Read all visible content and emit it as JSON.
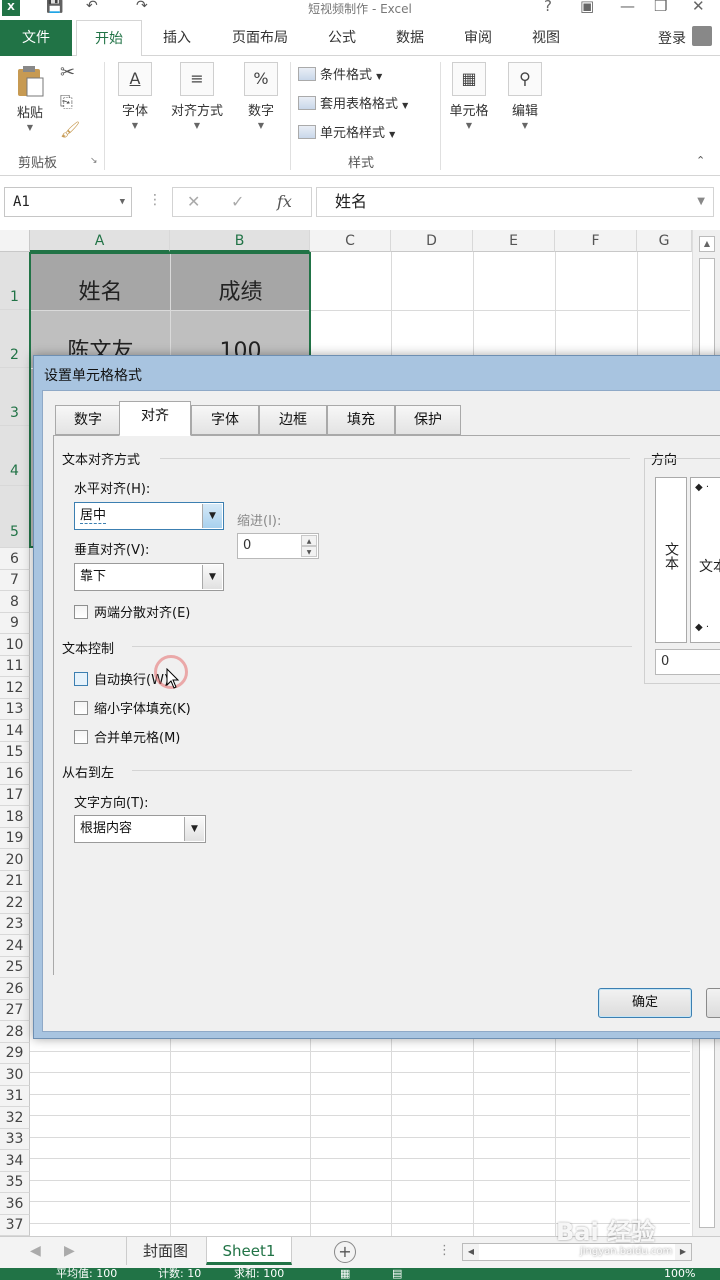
{
  "app": {
    "title": "短视频制作 - Excel",
    "logo": "X",
    "qa_save": "💾",
    "qa_undo": "↶",
    "qa_redo": "↷",
    "help": "?",
    "ribbon_display": "▣",
    "minimize": "—",
    "restore": "❐",
    "close": "✕"
  },
  "ribbon_tabs": [
    "文件",
    "开始",
    "插入",
    "页面布局",
    "公式",
    "数据",
    "审阅",
    "视图"
  ],
  "login": "登录",
  "ribbon": {
    "paste": "粘贴",
    "clipboard": "剪贴板",
    "font": "字体",
    "align": "对齐方式",
    "number": "数字",
    "number_icon": "%",
    "font_icon": "A",
    "cond_format": "条件格式",
    "table_format": "套用表格格式",
    "cell_style": "单元格样式",
    "styles": "样式",
    "cells": "单元格",
    "edit": "编辑"
  },
  "formula_bar": {
    "name_box": "A1",
    "cancel": "✕",
    "enter": "✓",
    "fx": "fx",
    "content": "姓名"
  },
  "grid": {
    "columns": [
      "A",
      "B",
      "C",
      "D",
      "E",
      "F",
      "G"
    ],
    "rows": [
      "1",
      "2",
      "3",
      "4",
      "5",
      "6",
      "7",
      "8",
      "9",
      "10",
      "11",
      "12",
      "13",
      "14",
      "15",
      "16",
      "17",
      "18",
      "19",
      "20",
      "21",
      "22",
      "23",
      "24",
      "25",
      "26",
      "27",
      "28",
      "29",
      "30",
      "31",
      "32",
      "33",
      "34",
      "35",
      "36",
      "37"
    ],
    "cells": {
      "a1": "姓名",
      "b1": "成绩",
      "a2": "陈文友",
      "b2": "100"
    }
  },
  "dialog": {
    "title": "设置单元格格式",
    "tabs": [
      "数字",
      "对齐",
      "字体",
      "边框",
      "填充",
      "保护"
    ],
    "active_tab": "对齐",
    "text_alignment": "文本对齐方式",
    "horizontal_label": "水平对齐(H):",
    "horizontal_value": "居中",
    "indent_label": "缩进(I):",
    "indent_value": "0",
    "vertical_label": "垂直对齐(V):",
    "vertical_value": "靠下",
    "justify_distributed": "两端分散对齐(E)",
    "text_control": "文本控制",
    "wrap_text": "自动换行(W)",
    "shrink_fit": "缩小字体填充(K)",
    "merge_cells": "合并单元格(M)",
    "rtl": "从右到左",
    "text_direction_label": "文字方向(T):",
    "text_direction_value": "根据内容",
    "orientation": "方向",
    "orientation_vertical_text": "文本",
    "orientation_text_partial": "文本",
    "orientation_degrees": "0",
    "ok": "确定"
  },
  "sheets": [
    "封面图",
    "Sheet1"
  ],
  "active_sheet": "Sheet1",
  "statusbar": {
    "avg": "平均值: 100",
    "count": "计数: 10",
    "sum": "求和: 100",
    "zoom": "100%"
  },
  "watermark": {
    "brand": "Bai 经验",
    "url": "jingyan.baidu.com"
  },
  "colors": {
    "accent": "#217346",
    "header_cell": "#a6a6a6",
    "data_cell": "#bfbfbf",
    "dialog_frame": "#a8c4e0"
  }
}
